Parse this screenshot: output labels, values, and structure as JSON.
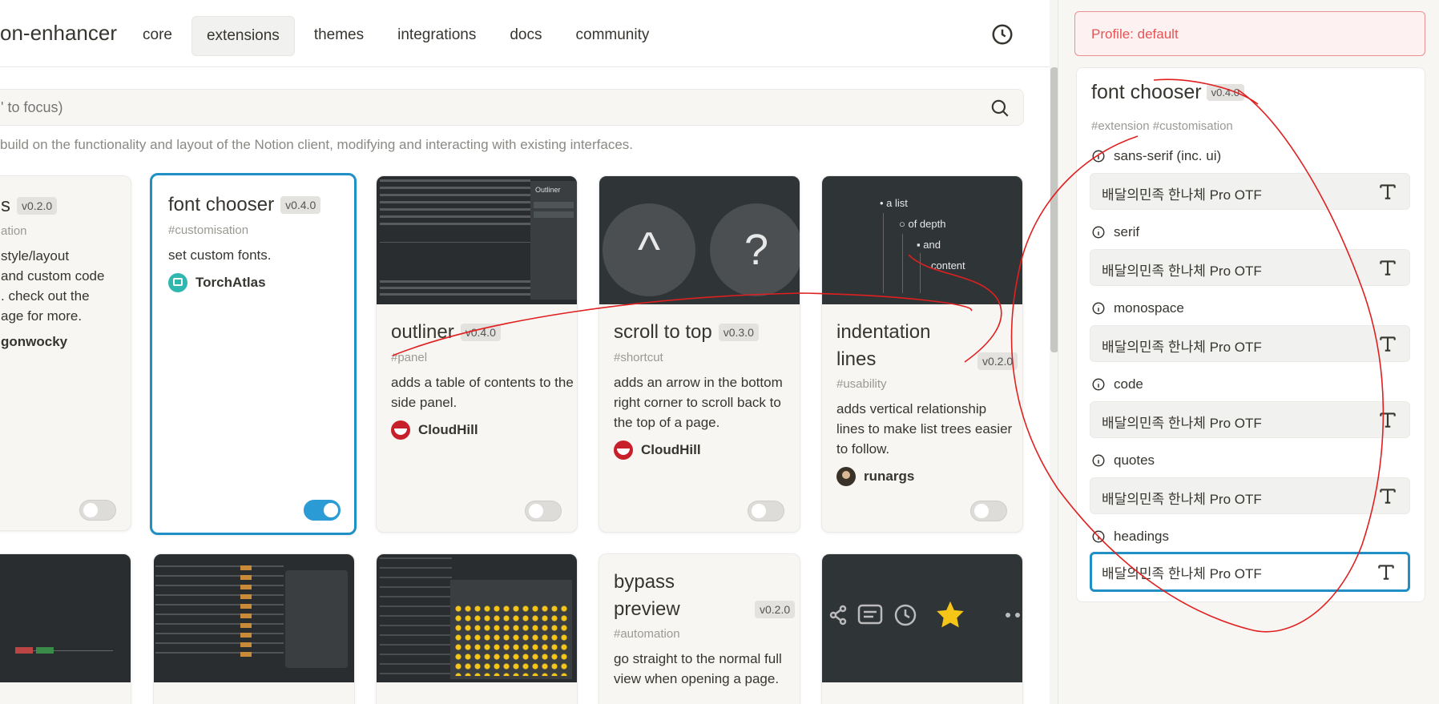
{
  "header": {
    "app_title": "on-enhancer",
    "nav": [
      "core",
      "extensions",
      "themes",
      "integrations",
      "docs",
      "community"
    ],
    "active_nav": "extensions",
    "history_icon": "clock-icon"
  },
  "search": {
    "placeholder": "' to focus)",
    "icon": "search-icon"
  },
  "description": "build on the functionality and layout of the Notion client, modifying and interacting with existing interfaces.",
  "cards_row1": [
    {
      "title": "s",
      "version": "v0.2.0",
      "tags": "ation",
      "desc": "style/layout and custom code . check out the age for more.",
      "desc_lines": [
        "style/layout",
        "and custom code",
        ". check out the",
        "age for more."
      ],
      "author": "gonwocky",
      "enabled": false
    },
    {
      "title": "font chooser",
      "version": "v0.4.0",
      "tags": "#customisation",
      "desc": "set custom fonts.",
      "author": "TorchAtlas",
      "enabled": true
    },
    {
      "title": "outliner",
      "version": "v0.4.0",
      "tags": "#panel",
      "desc": "adds a table of contents to the side panel.",
      "author": "CloudHill",
      "enabled": false
    },
    {
      "title": "scroll to top",
      "version": "v0.3.0",
      "tags": "#shortcut",
      "desc": "adds an arrow in the bottom right corner to scroll back to the top of a page.",
      "author": "CloudHill",
      "enabled": false
    },
    {
      "title": "indentation lines",
      "version": "v0.2.0",
      "tags": "#usability",
      "desc": "adds vertical relationship lines to make list trees easier to follow.",
      "author": "runargs",
      "enabled": false
    }
  ],
  "preview_text": {
    "scroll_up": "^",
    "scroll_q": "?",
    "indent": [
      "a list",
      "of depth",
      "and",
      "content"
    ],
    "outliner_label": "Outliner"
  },
  "cards_row2": [
    {
      "title": "bypass preview",
      "version": "v0.2.0",
      "tags": "#automation",
      "desc": "go straight to the normal full view when opening a page."
    }
  ],
  "panel": {
    "profile": "Profile: default",
    "ext_title": "font chooser",
    "ext_version": "v0.4.0",
    "ext_tags": "#extension #customisation",
    "options": [
      {
        "label": "sans-serif (inc. ui)",
        "value": "배달의민족 한나체 Pro OTF"
      },
      {
        "label": "serif",
        "value": "배달의민족 한나체 Pro OTF"
      },
      {
        "label": "monospace",
        "value": "배달의민족 한나체 Pro OTF"
      },
      {
        "label": "code",
        "value": "배달의민족 한나체 Pro OTF"
      },
      {
        "label": "quotes",
        "value": "배달의민족 한나체 Pro OTF"
      },
      {
        "label": "headings",
        "value": "배달의민족 한나체 Pro OTF"
      }
    ]
  },
  "colors": {
    "accent": "#1f8fc6",
    "toggle_on": "#2b9bd6",
    "profile_red": "#e45656",
    "annotation_red": "#e02020"
  }
}
